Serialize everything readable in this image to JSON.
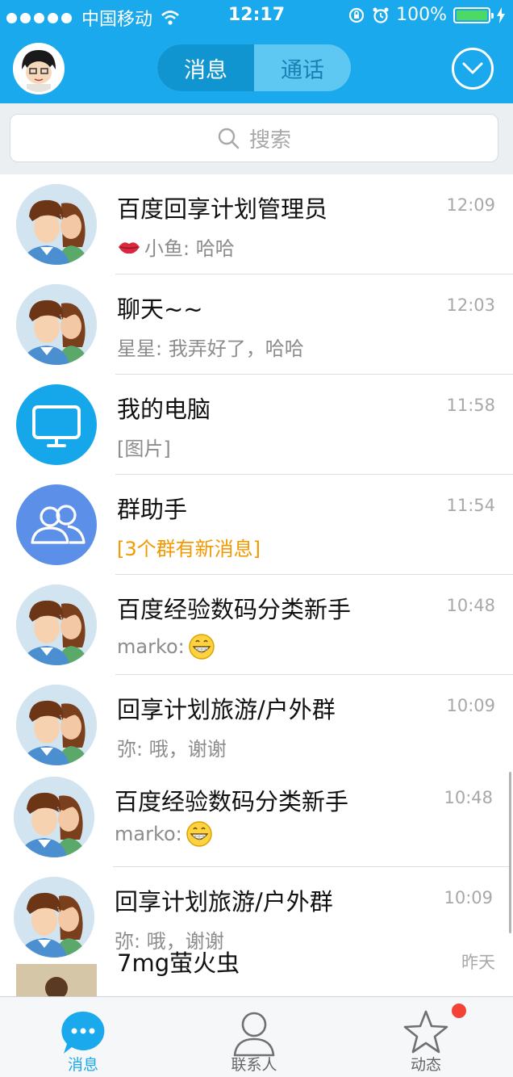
{
  "status_bar": {
    "carrier": "中国移动",
    "time": "12:17",
    "battery": "100%"
  },
  "header": {
    "tabs": [
      {
        "label": "消息",
        "active": true
      },
      {
        "label": "通话",
        "active": false
      }
    ]
  },
  "search": {
    "placeholder": "搜索"
  },
  "conversations": [
    {
      "title": "百度回享计划管理员",
      "subtitle": "小鱼: 哈哈",
      "time": "12:09",
      "avatar": "group-couple-avatar",
      "prefix_icon": "kiss-lips-icon"
    },
    {
      "title": "聊天~~",
      "subtitle": "星星: 我弄好了，哈哈",
      "time": "12:03",
      "avatar": "group-couple-avatar"
    },
    {
      "title": "我的电脑",
      "subtitle": "[图片]",
      "time": "11:58",
      "avatar": "monitor-icon"
    },
    {
      "title": "群助手",
      "subtitle": "[3个群有新消息]",
      "time": "11:54",
      "avatar": "group-helper-icon"
    },
    {
      "title": "百度经验数码分类新手",
      "subtitle": "marko:",
      "time": "10:48",
      "avatar": "group-couple-avatar",
      "suffix_icon": "grin-emoji-icon"
    },
    {
      "title": "回享计划旅游/户外群",
      "subtitle": "弥: 哦，谢谢",
      "time": "10:09",
      "avatar": "group-couple-avatar"
    },
    {
      "title": "百度经验数码分类新手",
      "subtitle": "marko:",
      "time": "10:48",
      "avatar": "group-couple-avatar",
      "suffix_icon": "grin-emoji-icon"
    },
    {
      "title": "回享计划旅游/户外群",
      "subtitle": "弥: 哦，谢谢",
      "time": "10:09",
      "avatar": "group-couple-avatar"
    },
    {
      "title": "7mg萤火虫",
      "subtitle": "",
      "time": "昨天",
      "avatar": "photo-avatar"
    }
  ],
  "tabbar": {
    "items": [
      {
        "label": "消息",
        "icon": "chat-bubble-icon",
        "active": true
      },
      {
        "label": "联系人",
        "icon": "contact-person-icon",
        "active": false
      },
      {
        "label": "动态",
        "icon": "star-icon",
        "active": false,
        "badge": true
      }
    ]
  },
  "colors": {
    "header_blue": "#1aa9ec",
    "segment_active": "#1195d0",
    "highlight_orange": "#f39800",
    "badge_red": "#f44236"
  }
}
